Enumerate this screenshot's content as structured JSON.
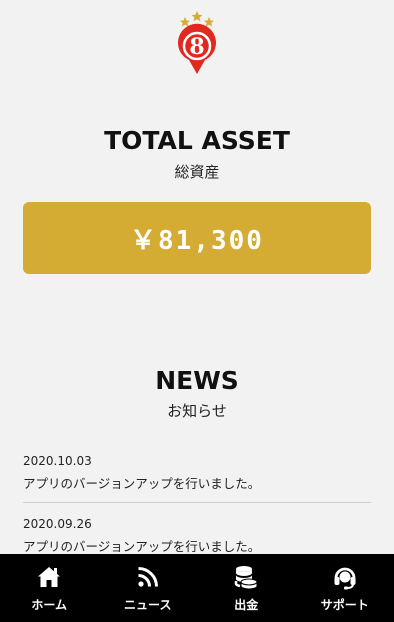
{
  "logo": {
    "number": "8"
  },
  "total_asset": {
    "title": "TOTAL ASSET",
    "subtitle": "総資産",
    "value": "￥81,300"
  },
  "news": {
    "title": "NEWS",
    "subtitle": "お知らせ",
    "items": [
      {
        "date": "2020.10.03",
        "text": "アプリのバージョンアップを行いました。"
      },
      {
        "date": "2020.09.26",
        "text": "アプリのバージョンアップを行いました。"
      }
    ]
  },
  "nav": {
    "items": [
      {
        "label": "ホーム",
        "icon": "home-icon"
      },
      {
        "label": "ニュース",
        "icon": "rss-icon"
      },
      {
        "label": "出金",
        "icon": "coins-icon"
      },
      {
        "label": "サポート",
        "icon": "headset-icon"
      }
    ]
  },
  "colors": {
    "accent": "#d4ab33",
    "logo_red": "#e02a1f",
    "nav_bg": "#000000"
  }
}
